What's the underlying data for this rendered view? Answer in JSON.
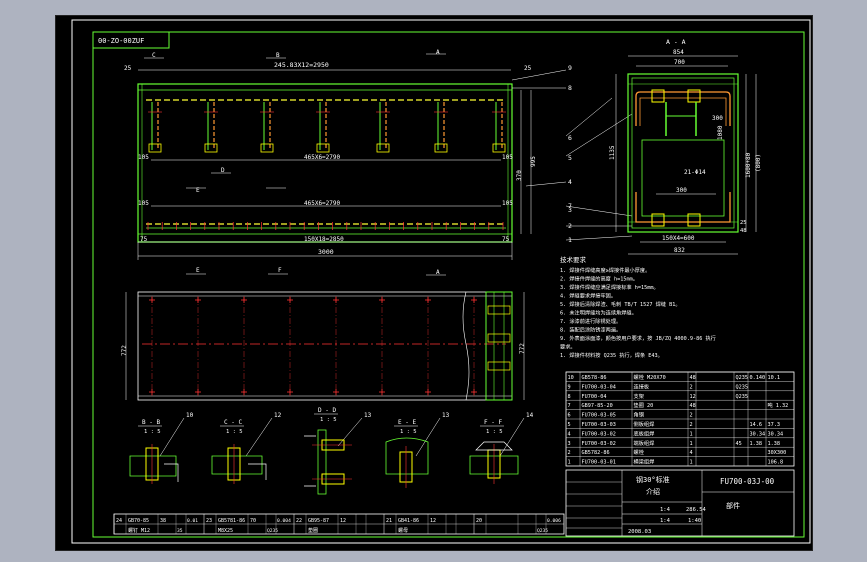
{
  "drawing": {
    "title_block_code": "FU700-03J-00",
    "sheet_code_top": "00-ZO-00ZUF",
    "title_block_name_1": "钢30°标准",
    "title_block_name_2": "介绍",
    "part_label": "部件",
    "scale_1": "1:4",
    "scale_2": "1:4",
    "weight": "286.54",
    "qty": "1:40",
    "date": "2008.03"
  },
  "front_view": {
    "top_dim": "245.83X12=2950",
    "top_edge_dim_left": "25",
    "top_edge_dim_right": "25",
    "mid_dim_1": "465X6=2790",
    "mid_dim_2": "465X6=2790",
    "bottom_dim_1": "150X18=2850",
    "bottom_dim_2": "3000",
    "left_end_1": "105",
    "right_end_1": "105",
    "left_end_2": "105",
    "right_end_2": "105",
    "left_end_3": "75",
    "right_end_3": "75",
    "height_1": "370",
    "height_2": "995",
    "section_c": "C",
    "section_b": "B",
    "section_a": "A",
    "section_d": "D",
    "section_e": "E",
    "section_f": "F"
  },
  "side_view": {
    "section_label": "A - A",
    "top_dim_outer": "854",
    "top_dim_inner": "700",
    "left_height": "1135",
    "right_height_1": "1600+80",
    "right_height_2": "(800)",
    "right_height_3": "1080",
    "inner_dim_1": "300",
    "inner_dim_2": "21-Φ14",
    "inner_dim_3": "300",
    "bottom_dim_1": "150X4=600",
    "bottom_dim_2": "832",
    "small_dim_1": "25",
    "small_dim_2": "48"
  },
  "plan_view": {
    "height_left": "772",
    "height_right": "772"
  },
  "callouts": [
    "9",
    "8",
    "6",
    "5",
    "4",
    "3",
    "2",
    "7",
    "1"
  ],
  "notes": {
    "heading": "技术要求",
    "lines": [
      "1. 焊接件焊缝高度≥焊接件最小厚度。",
      "2. 焊接件焊缝的高度 h=15mm。",
      "3. 焊接件焊缝应满足焊接标准 h=15mm。",
      "4. 焊缝要求焊接牢固。",
      "5. 焊接后清除焊渣、毛刺 TB/T 1527 焊缝 B1。",
      "6. 未注明焊缝均为连续角焊缝。",
      "7. 涂漆前进行除锈处理。",
      "8. 装配后涂防锈漆两遍。",
      "9. 外表面涂面漆，颜色按用户要求，按 JB/ZQ 4000.9-86 执行",
      "要求。",
      "1. 焊接件材料按 Q235 执行，焊条 E43。"
    ]
  },
  "sections": [
    {
      "label": "B - B",
      "scale": "1 : 5",
      "callout": "10"
    },
    {
      "label": "C - C",
      "scale": "1 : 5",
      "callout": "12"
    },
    {
      "label": "D - D",
      "scale": "1 : 5",
      "callout": "13"
    },
    {
      "label": "E - E",
      "scale": "1 : 5",
      "callout": "13"
    },
    {
      "label": "F - F",
      "scale": "1 : 5",
      "callout": "14"
    }
  ],
  "bom_rows": [
    {
      "no": "10",
      "code": "GB578-86",
      "name": "螺栓 M20X70",
      "qty": "48",
      "mat": "Q235",
      "w1": "0.140",
      "w2": "10.1"
    },
    {
      "no": "9",
      "code": "FU700-03-04",
      "name": "连接板",
      "qty": "2",
      "mat": "Q235",
      "w1": "",
      "w2": ""
    },
    {
      "no": "8",
      "code": "FU700-04",
      "name": "支架",
      "qty": "12",
      "mat": "Q235",
      "w1": "",
      "w2": ""
    },
    {
      "no": "7",
      "code": "GB97-85-20",
      "name": "垫圈 20",
      "qty": "48",
      "mat": "",
      "w1": "",
      "w2": "吨 1.32"
    },
    {
      "no": "6",
      "code": "FU700-03-05",
      "name": "角钢",
      "qty": "2",
      "mat": "",
      "w1": "",
      "w2": ""
    },
    {
      "no": "5",
      "code": "FU700-03-03",
      "name": "侧板组焊",
      "qty": "2",
      "mat": "",
      "w1": "14.6",
      "w2": "37.3"
    },
    {
      "no": "4",
      "code": "FU700-03-02",
      "name": "底板组焊",
      "qty": "1",
      "mat": "",
      "w1": "30.34",
      "w2": "30.34"
    },
    {
      "no": "3",
      "code": "FU700-03-02",
      "name": "端板组焊",
      "qty": "1",
      "mat": "45",
      "w1": "1.38",
      "w2": "1.38"
    },
    {
      "no": "2",
      "code": "GB5782-86",
      "name": "螺栓",
      "qty": "4",
      "mat": "",
      "w1": "",
      "w2": "30X300"
    },
    {
      "no": "1",
      "code": "FU700-03-01",
      "name": "横梁组焊",
      "qty": "1",
      "mat": "",
      "w1": "",
      "w2": "106.8"
    }
  ],
  "bottom_bom": [
    {
      "no": "24",
      "code": "GB70-85",
      "name": "螺钉 M12",
      "qty": "38",
      "mat": "35",
      "w": "0.01"
    },
    {
      "no": "23",
      "code": "GB5781-86",
      "name": "M8X25",
      "qty": "70",
      "mat": "Q235",
      "w": "0.004"
    },
    {
      "no": "22",
      "code": "GB95-87",
      "name": "垫圈",
      "qty": "12",
      "mat": "",
      "w": ""
    },
    {
      "no": "21",
      "code": "GB41-86",
      "name": "螺母",
      "qty": "12",
      "mat": "",
      "w": ""
    },
    {
      "no": "20",
      "code": "",
      "name": "",
      "qty": "",
      "mat": "Q235",
      "w": "0.006"
    }
  ],
  "colors": {
    "background": "#000000",
    "outline": "#66ff33",
    "hidden_line": "#ffff33",
    "center_line": "#ff3333",
    "dimension": "#ffffff",
    "callout": "#ffff00"
  }
}
